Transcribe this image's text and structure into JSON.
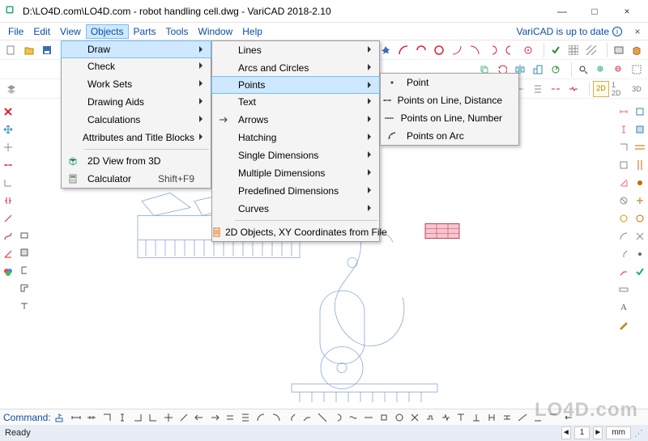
{
  "window": {
    "title": "D:\\LO4D.com\\LO4D.com - robot handling cell.dwg - VariCAD 2018-2.10",
    "minimize": "—",
    "maximize": "□",
    "close": "×"
  },
  "menubar": {
    "items": [
      "File",
      "Edit",
      "View",
      "Objects",
      "Parts",
      "Tools",
      "Window",
      "Help"
    ],
    "selected_index": 3,
    "right_text": "VariCAD is up to date"
  },
  "dropdown1": {
    "items": [
      {
        "label": "Draw",
        "arrow": true,
        "sel": true
      },
      {
        "label": "Check",
        "arrow": true
      },
      {
        "label": "Work Sets",
        "arrow": true
      },
      {
        "label": "Drawing Aids",
        "arrow": true
      },
      {
        "label": "Calculations",
        "arrow": true
      },
      {
        "label": "Attributes and Title Blocks",
        "arrow": true
      },
      {
        "sep": true
      },
      {
        "label": "2D View from 3D",
        "icon": "cube"
      },
      {
        "label": "Calculator",
        "shortcut": "Shift+F9",
        "icon": "calc"
      }
    ]
  },
  "dropdown2": {
    "items": [
      {
        "label": "Lines",
        "arrow": true
      },
      {
        "label": "Arcs and Circles",
        "arrow": true
      },
      {
        "label": "Points",
        "arrow": true,
        "sel": true
      },
      {
        "label": "Text",
        "arrow": true
      },
      {
        "label": "Arrows",
        "arrow": true,
        "icon": "arrow"
      },
      {
        "label": "Hatching",
        "arrow": true
      },
      {
        "label": "Single Dimensions",
        "arrow": true
      },
      {
        "label": "Multiple Dimensions",
        "arrow": true
      },
      {
        "label": "Predefined Dimensions",
        "arrow": true
      },
      {
        "label": "Curves",
        "arrow": true
      },
      {
        "sep": true
      },
      {
        "label": "2D Objects, XY Coordinates from File",
        "icon": "file"
      }
    ]
  },
  "dropdown3": {
    "items": [
      {
        "label": "Point",
        "icon": "pt"
      },
      {
        "label": "Points on Line, Distance",
        "icon": "ptd"
      },
      {
        "label": "Points on Line, Number",
        "icon": "ptn"
      },
      {
        "label": "Points on Arc",
        "icon": "pta"
      }
    ]
  },
  "commandline": {
    "label": "Command:"
  },
  "statusbar": {
    "ready": "Ready",
    "segments": [
      "1",
      "mm"
    ]
  },
  "watermark": "LO4D.com"
}
